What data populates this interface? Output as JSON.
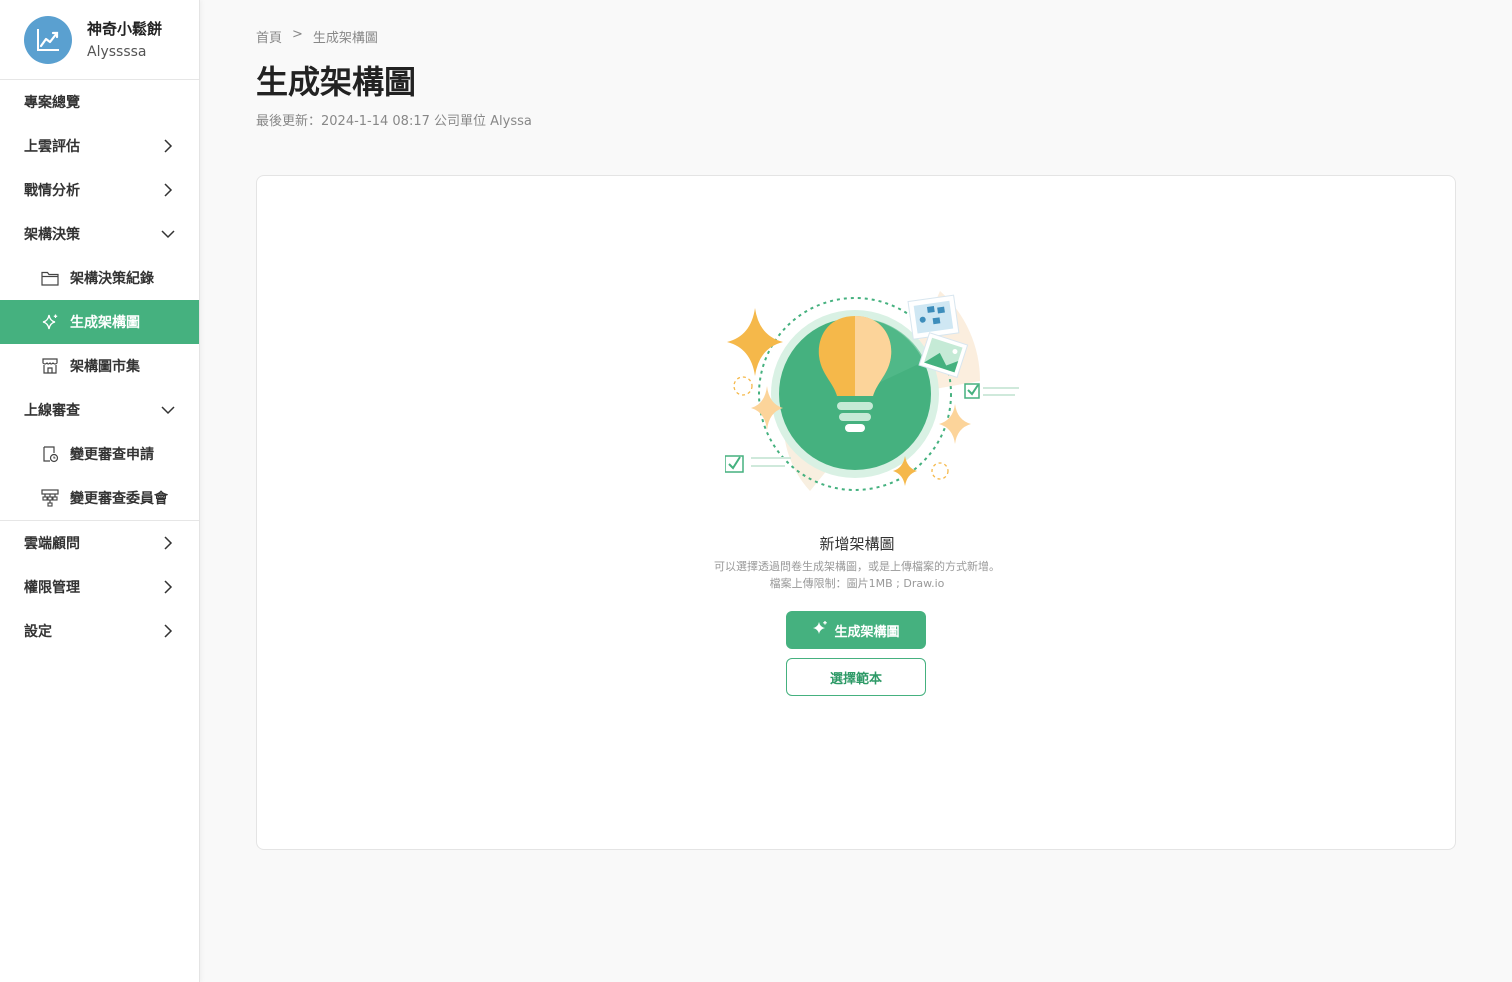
{
  "sidebar": {
    "profile": {
      "name": "神奇小鬆餅",
      "username": "Alyssssa"
    },
    "items": [
      {
        "label": "專案總覽"
      },
      {
        "label": "上雲評估"
      },
      {
        "label": "戰情分析"
      },
      {
        "label": "架構決策"
      },
      {
        "label": "架構決策紀錄",
        "icon": "folder-icon"
      },
      {
        "label": "生成架構圖",
        "icon": "sparkle-icon"
      },
      {
        "label": "架構圖市集",
        "icon": "store-icon"
      },
      {
        "label": "上線審查"
      },
      {
        "label": "變更審查申請",
        "icon": "review-doc-icon"
      },
      {
        "label": "變更審查委員會",
        "icon": "org-chart-icon"
      },
      {
        "label": "雲端顧問"
      },
      {
        "label": "權限管理"
      },
      {
        "label": "設定"
      }
    ]
  },
  "breadcrumb": {
    "home": "首頁",
    "separator": ">",
    "current": "生成架構圖"
  },
  "page": {
    "title": "生成架構圖",
    "meta": "最後更新：2024-1-14 08:17 公司單位 Alyssa"
  },
  "empty_state": {
    "title": "新增架構圖",
    "desc_line1": "可以選擇透過問卷生成架構圖，或是上傳檔案的方式新增。",
    "desc_line2": "檔案上傳限制：圖片1MB ; Draw.io",
    "primary_button": "生成架構圖",
    "secondary_button": "選擇範本"
  },
  "colors": {
    "accent": "#45b17f",
    "accent_dark": "#2e9a67",
    "bulb": "#f5b84a",
    "avatar": "#5aa0d0"
  }
}
